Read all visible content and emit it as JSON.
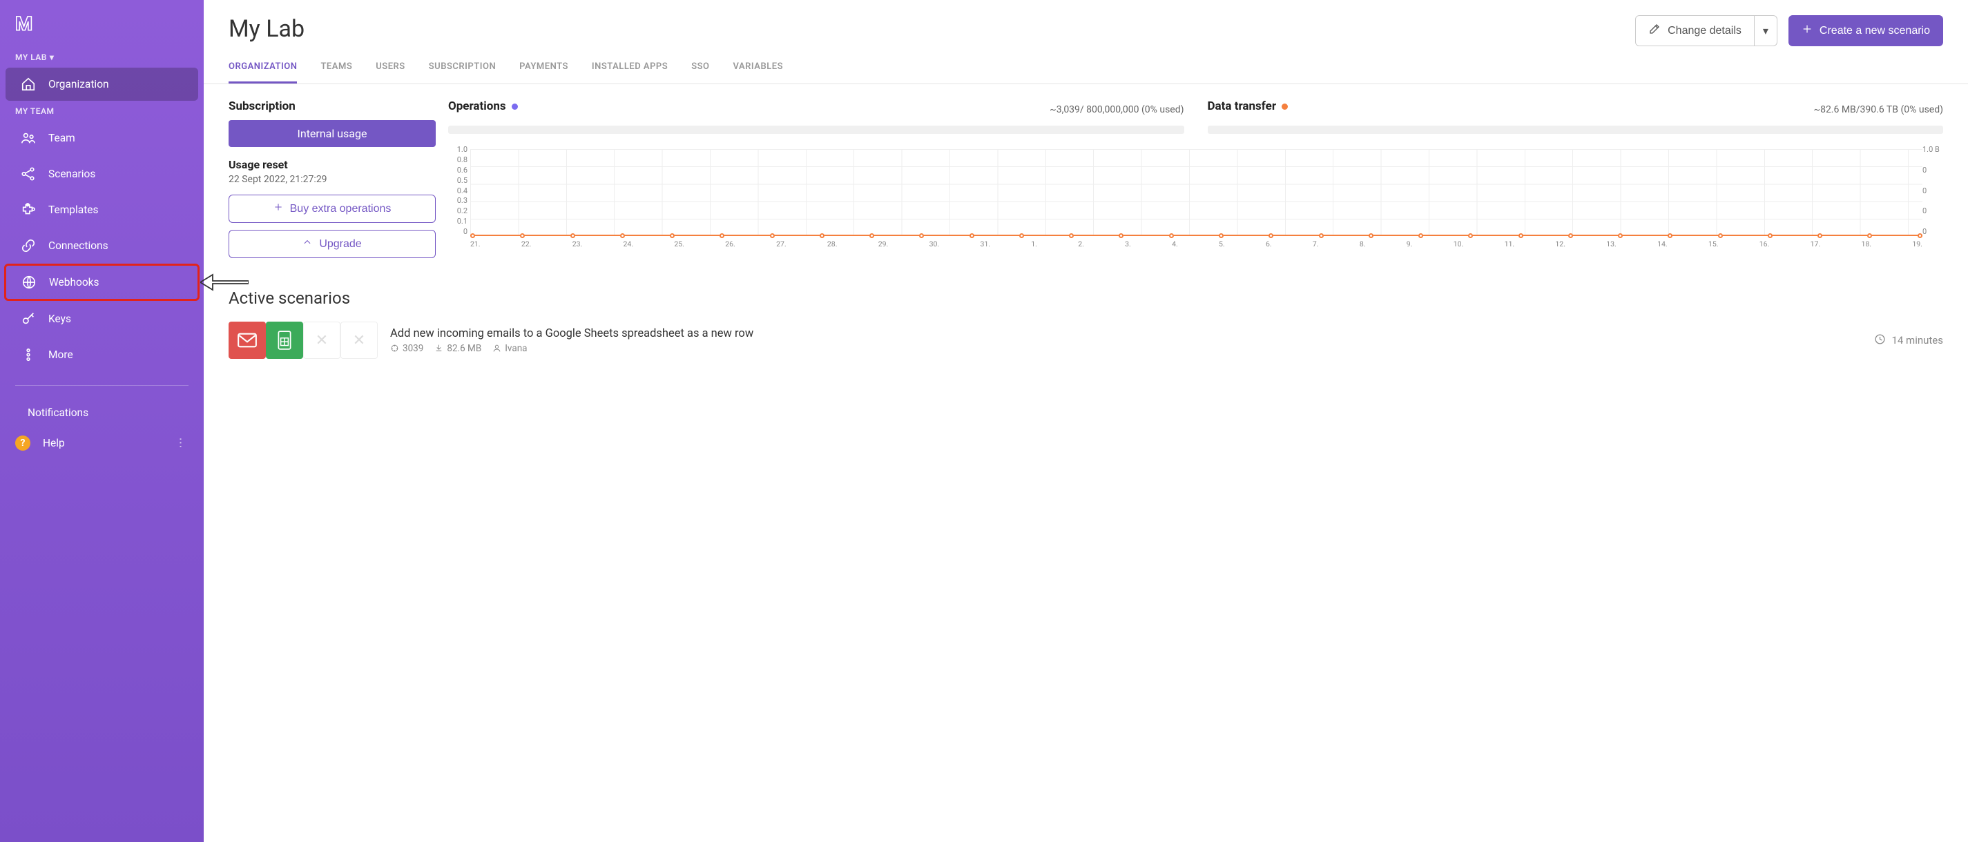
{
  "sidebar": {
    "org_label": "MY LAB",
    "team_label": "MY TEAM",
    "items": {
      "organization": "Organization",
      "team": "Team",
      "scenarios": "Scenarios",
      "templates": "Templates",
      "connections": "Connections",
      "webhooks": "Webhooks",
      "keys": "Keys",
      "more": "More"
    },
    "footer": {
      "notifications": "Notifications",
      "help": "Help"
    }
  },
  "header": {
    "title": "My Lab",
    "change_details": "Change details",
    "create_scenario": "Create a new scenario"
  },
  "tabs": [
    "ORGANIZATION",
    "TEAMS",
    "USERS",
    "SUBSCRIPTION",
    "PAYMENTS",
    "INSTALLED APPS",
    "SSO",
    "VARIABLES"
  ],
  "subscription": {
    "title": "Subscription",
    "badge": "Internal usage",
    "reset_label": "Usage reset",
    "reset_ts": "22 Sept 2022, 21:27:29",
    "buy_extra": "Buy extra operations",
    "upgrade": "Upgrade"
  },
  "operations": {
    "title": "Operations",
    "stats": "~3,039/ 800,000,000 (0% used)"
  },
  "datatransfer": {
    "title": "Data transfer",
    "stats": "~82.6 MB/390.6 TB (0% used)"
  },
  "chart_data": {
    "type": "line",
    "x_ticks": [
      "21.",
      "22.",
      "23.",
      "24.",
      "25.",
      "26.",
      "27.",
      "28.",
      "29.",
      "30.",
      "31.",
      "1.",
      "2.",
      "3.",
      "4.",
      "5.",
      "6.",
      "7.",
      "8.",
      "9.",
      "10.",
      "11.",
      "12.",
      "13.",
      "14.",
      "15.",
      "16.",
      "17.",
      "18.",
      "19."
    ],
    "y_ticks_left": [
      "1.0",
      "0.8",
      "0.6",
      "0.5",
      "0.4",
      "0.3",
      "0.2",
      "0.1",
      "0"
    ],
    "y_ticks_right": [
      "1.0 B",
      "0",
      "0",
      "0",
      "0"
    ],
    "series": [
      {
        "name": "operations",
        "values": [
          0,
          0,
          0,
          0,
          0,
          0,
          0,
          0,
          0,
          0,
          0,
          0,
          0,
          0,
          0,
          0,
          0,
          0,
          0,
          0,
          0,
          0,
          0,
          0,
          0,
          0,
          0,
          0,
          0,
          0
        ]
      }
    ],
    "title": "",
    "xlabel": "",
    "ylabel": "",
    "ylim": [
      0,
      1
    ]
  },
  "active_scenarios": {
    "title": "Active scenarios",
    "rows": [
      {
        "title": "Add new incoming emails to a Google Sheets spreadsheet as a new row",
        "ops": "3039",
        "data": "82.6 MB",
        "owner": "Ivana",
        "time": "14 minutes"
      }
    ]
  }
}
